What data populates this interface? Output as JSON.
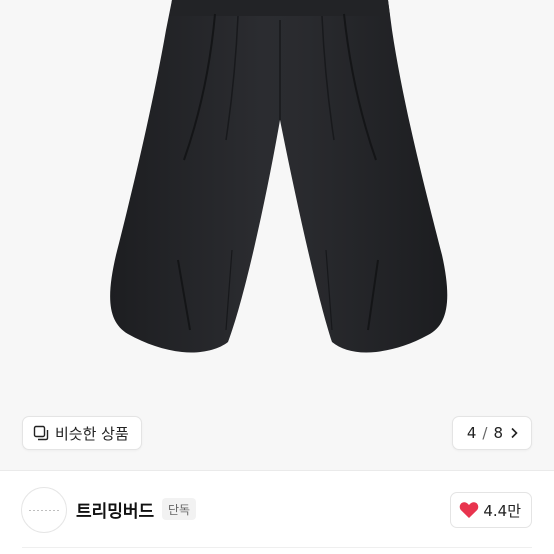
{
  "gallery": {
    "image_alt_icon": "trousers-product-image",
    "similar_button": {
      "icon": "similar-icon",
      "label": "비슷한 상품"
    },
    "counter": {
      "current": "4",
      "separator": "/",
      "total": "8",
      "icon": "chevron-right-icon"
    }
  },
  "brand": {
    "name": "트리밍버드",
    "badge": "단독",
    "like": {
      "icon": "heart-icon",
      "count": "4.4만",
      "color": "#e8344e"
    }
  }
}
